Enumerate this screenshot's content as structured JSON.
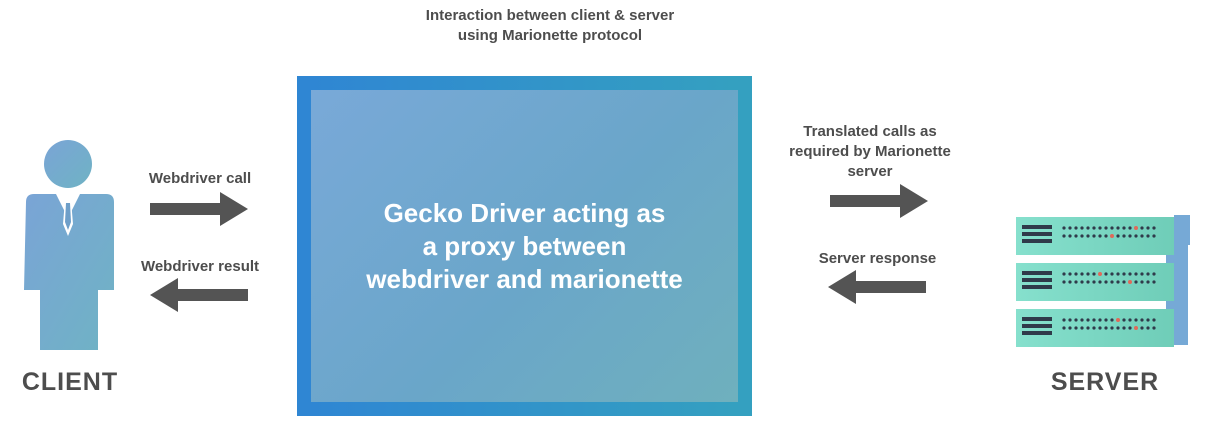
{
  "title": "Interaction between client & server\nusing Marionette protocol",
  "proxy_box": {
    "text": "Gecko Driver acting as\na proxy between\nwebdriver and marionette",
    "border_color": "#2f86d1",
    "fill_color": "#72a8cf"
  },
  "client": {
    "label": "CLIENT",
    "icon": "person-icon",
    "color": "#74a8cf"
  },
  "server": {
    "label": "SERVER",
    "icon": "server-rack-icon",
    "color": "#7fd6c2"
  },
  "arrows": {
    "webdriver_call": "Webdriver call",
    "webdriver_result": "Webdriver result",
    "translated_calls": "Translated calls as\nrequired by Marionette\nserver",
    "server_response": "Server response",
    "arrow_color": "#545454"
  }
}
